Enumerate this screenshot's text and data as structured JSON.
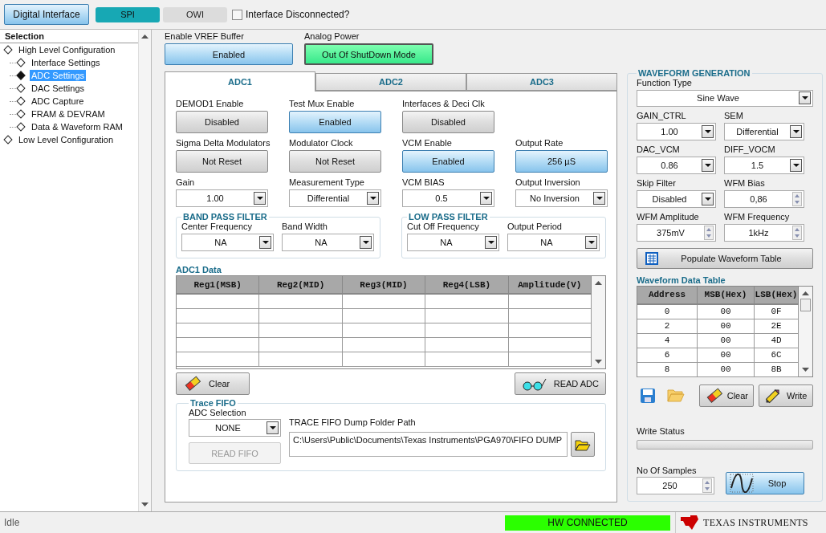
{
  "toolbar": {
    "interface_button": "Digital Interface",
    "modes": [
      {
        "label": "SPI",
        "selected": true
      },
      {
        "label": "OWI",
        "selected": false
      }
    ],
    "disconnected": {
      "label": "Interface Disconnected?",
      "checked": false
    }
  },
  "sidebar": {
    "title": "Selection",
    "tree": [
      {
        "label": "High Level Configuration",
        "selected": false,
        "children": [
          {
            "label": "Interface Settings",
            "selected": false
          },
          {
            "label": "ADC Settings",
            "selected": true
          },
          {
            "label": "DAC Settings",
            "selected": false
          },
          {
            "label": "ADC Capture",
            "selected": false
          },
          {
            "label": "FRAM & DEVRAM",
            "selected": false
          },
          {
            "label": "Data & Waveform RAM",
            "selected": false
          }
        ]
      },
      {
        "label": "Low Level Configuration",
        "selected": false
      }
    ]
  },
  "top_controls": [
    {
      "label": "Enable VREF Buffer",
      "value": "Enabled",
      "kind": "toggle",
      "on": true
    },
    {
      "label": "Analog Power",
      "value": "Out Of ShutDown Mode",
      "kind": "power",
      "on": true
    }
  ],
  "tabs": [
    {
      "label": "ADC1",
      "selected": true
    },
    {
      "label": "ADC2",
      "selected": false
    },
    {
      "label": "ADC3",
      "selected": false
    }
  ],
  "controls": [
    [
      {
        "label": "DEMOD1 Enable",
        "value": "Disabled",
        "kind": "toggle",
        "on": false
      },
      {
        "label": "Test Mux Enable",
        "value": "Enabled",
        "kind": "toggle",
        "on": true
      },
      {
        "label": "Interfaces & Deci Clk",
        "value": "Disabled",
        "kind": "toggle",
        "on": false
      }
    ],
    [
      {
        "label": "Sigma Delta Modulators",
        "value": "Not Reset",
        "kind": "toggle",
        "on": false
      },
      {
        "label": "Modulator Clock",
        "value": "Not Reset",
        "kind": "toggle",
        "on": false
      },
      {
        "label": "VCM Enable",
        "value": "Enabled",
        "kind": "toggle",
        "on": true
      },
      {
        "label": "Output Rate",
        "value": "256 µS",
        "kind": "toggle",
        "on": true
      }
    ],
    [
      {
        "label": "Gain",
        "value": "1.00",
        "kind": "select"
      },
      {
        "label": "Measurement Type",
        "value": "Differential",
        "kind": "select"
      },
      {
        "label": "VCM BIAS",
        "value": "0.5",
        "kind": "select"
      },
      {
        "label": "Output Inversion",
        "value": "No Inversion",
        "kind": "select"
      }
    ]
  ],
  "filters": [
    {
      "title": "BAND PASS FILTER",
      "fields": [
        {
          "label": "Center Frequency",
          "value": "NA"
        },
        {
          "label": "Band Width",
          "value": "NA"
        }
      ]
    },
    {
      "title": "LOW PASS FILTER",
      "fields": [
        {
          "label": "Cut Off Frequency",
          "value": "NA"
        },
        {
          "label": "Output Period",
          "value": "NA"
        }
      ]
    }
  ],
  "adc_data": {
    "title": "ADC1 Data",
    "columns": [
      "Reg1(MSB)",
      "Reg2(MID)",
      "Reg3(MID)",
      "Reg4(LSB)",
      "Amplitude(V)"
    ],
    "clear_button": "Clear",
    "read_button": "READ ADC"
  },
  "trace_fifo": {
    "title": "Trace FIFO",
    "selection_label": "ADC Selection",
    "selection": "NONE",
    "read_button": {
      "label": "READ FIFO",
      "disabled": true
    },
    "path_label": "TRACE FIFO Dump Folder Path",
    "path": "C:\\Users\\Public\\Documents\\Texas Instruments\\PGA970\\FIFO DUMP"
  },
  "waveform": {
    "title": "WAVEFORM GENERATION",
    "function_type": {
      "label": "Function Type",
      "value": "Sine Wave"
    },
    "fields": [
      {
        "label": "GAIN_CTRL",
        "value": "1.00",
        "kind": "select"
      },
      {
        "label": "SEM",
        "value": "Differential",
        "kind": "select"
      },
      {
        "label": "DAC_VCM",
        "value": "0.86",
        "kind": "select"
      },
      {
        "label": "DIFF_VOCM",
        "value": "1.5",
        "kind": "select"
      },
      {
        "label": "Skip Filter",
        "value": "Disabled",
        "kind": "select"
      },
      {
        "label": "WFM Bias",
        "value": "0,86",
        "kind": "spin"
      },
      {
        "label": "WFM Amplitude",
        "value": "375mV",
        "kind": "spin"
      },
      {
        "label": "WFM Frequency",
        "value": "1kHz",
        "kind": "spin"
      }
    ],
    "populate_button": "Populate Waveform Table",
    "table": {
      "title": "Waveform Data Table",
      "columns": [
        "Address",
        "MSB(Hex)",
        "LSB(Hex)"
      ],
      "rows": [
        [
          "0",
          "00",
          "0F"
        ],
        [
          "2",
          "00",
          "2E"
        ],
        [
          "4",
          "00",
          "4D"
        ],
        [
          "6",
          "00",
          "6C"
        ],
        [
          "8",
          "00",
          "8B"
        ]
      ]
    },
    "clear_button": "Clear",
    "write_button": "Write",
    "write_status": {
      "label": "Write Status",
      "level": 0
    },
    "samples": {
      "label": "No Of  Samples",
      "value": "250"
    },
    "stop_button": "Stop"
  },
  "status_bar": {
    "status": "Idle",
    "connection": "HW CONNECTED",
    "brand": "TEXAS INSTRUMENTS"
  }
}
